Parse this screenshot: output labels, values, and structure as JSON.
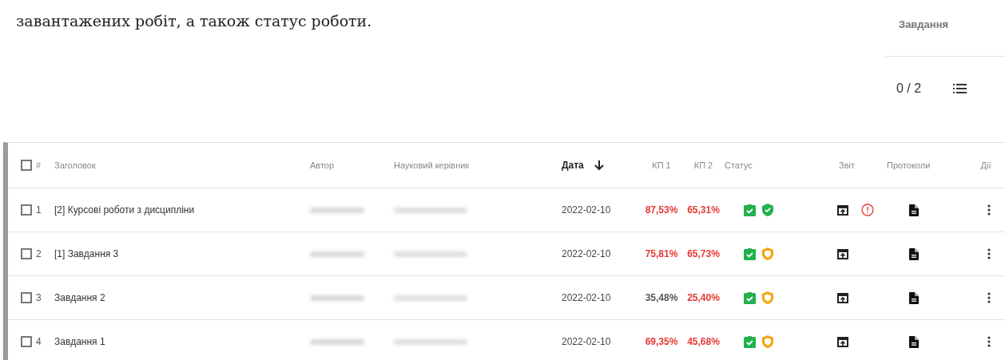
{
  "intro_text": "завантажених робіт,  а також статус роботи.",
  "side_panel": {
    "title": "Завдання",
    "counter": "0 / 2"
  },
  "table": {
    "select_all": {
      "checked": false
    },
    "columns": [
      {
        "kind": "number",
        "label": "#"
      },
      {
        "kind": "title",
        "label": "Заголовок"
      },
      {
        "kind": "author",
        "label": "Автор"
      },
      {
        "kind": "supervisor",
        "label": "Науковий керівник"
      },
      {
        "kind": "date",
        "label": "Дата",
        "sorted": true
      },
      {
        "kind": "kp1",
        "label": "КП 1"
      },
      {
        "kind": "kp2",
        "label": "КП 2"
      },
      {
        "kind": "status",
        "label": "Статус"
      },
      {
        "kind": "report",
        "label": "Звіт"
      },
      {
        "kind": "protocols",
        "label": "Протоколи"
      },
      {
        "kind": "actions",
        "label": "Дії"
      }
    ],
    "rows": [
      {
        "checked": false,
        "number": "1",
        "title": "[2] Курсові роботи з дисципліни",
        "date": "2022-02-10",
        "kp1": {
          "text": "87,53%",
          "color": "#e53935"
        },
        "kp2": {
          "text": "65,31%",
          "color": "#e53935"
        },
        "shield": {
          "color": "#22b14c"
        },
        "report_warning": true
      },
      {
        "checked": false,
        "number": "2",
        "title": "[1] Завдання 3",
        "date": "2022-02-10",
        "kp1": {
          "text": "75,81%",
          "color": "#e53935"
        },
        "kp2": {
          "text": "65,73%",
          "color": "#e53935"
        },
        "shield": {
          "color": "#f5a511"
        },
        "report_warning": false
      },
      {
        "checked": false,
        "number": "3",
        "title": "Завдання 2",
        "date": "2022-02-10",
        "kp1": {
          "text": "35,48%",
          "color": "#555555"
        },
        "kp2": {
          "text": "25,40%",
          "color": "#e53935"
        },
        "shield": {
          "color": "#f5a511"
        },
        "report_warning": false
      },
      {
        "checked": false,
        "number": "4",
        "title": "Завдання 1",
        "date": "2022-02-10",
        "kp1": {
          "text": "69,35%",
          "color": "#e53935"
        },
        "kp2": {
          "text": "45,68%",
          "color": "#e53935"
        },
        "shield": {
          "color": "#f5a511"
        },
        "report_warning": false
      }
    ]
  }
}
